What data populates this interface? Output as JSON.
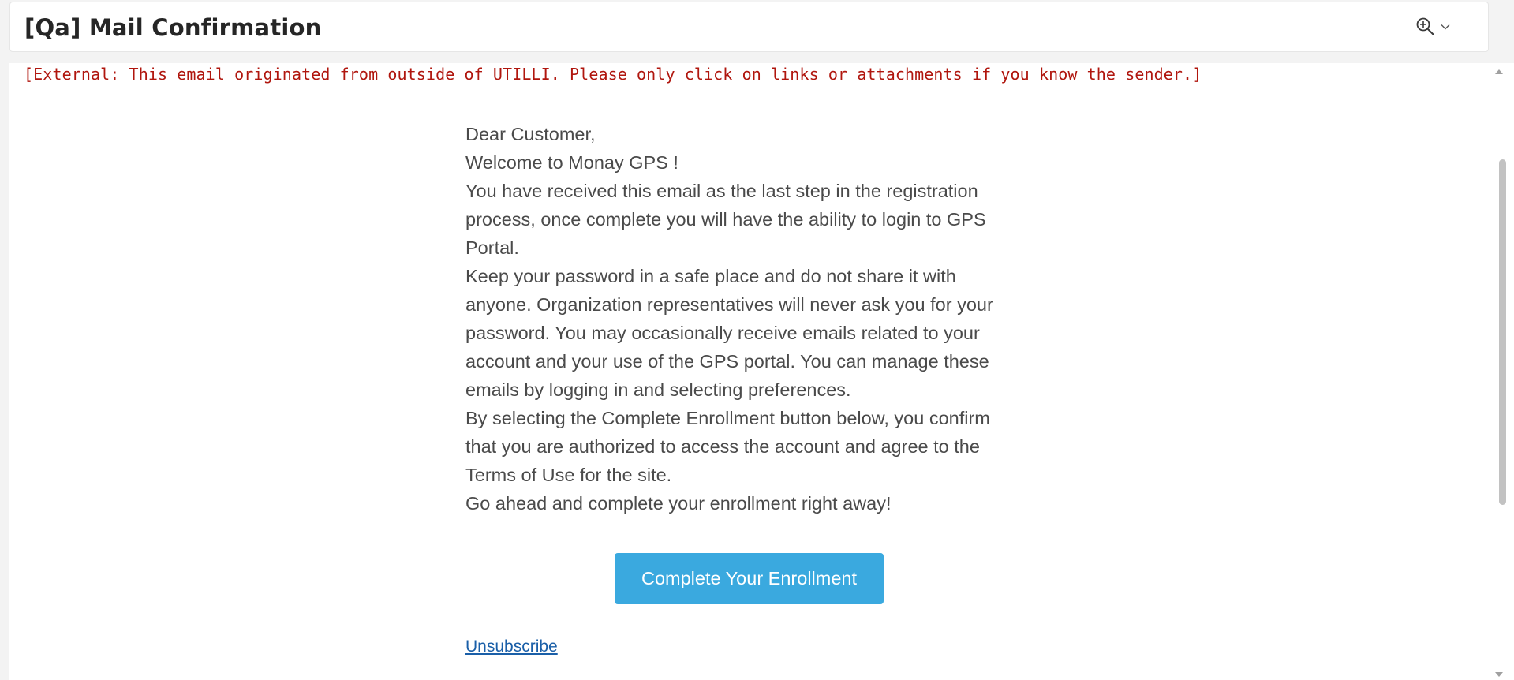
{
  "header": {
    "subject": "[Qa] Mail Confirmation",
    "zoom_icon": "zoom-in-icon",
    "zoom_dropdown_icon": "chevron-down-icon"
  },
  "warning": {
    "text": "[External: This email originated from outside of UTILLI. Please only click on links or attachments if you know the sender.]",
    "color": "#b0160e"
  },
  "email": {
    "greeting": "Dear Customer,",
    "welcome": "Welcome to Monay GPS !",
    "paragraphs": [
      "You have received this email as the last step in the registration process, once complete you will have the ability to login to GPS Portal.",
      "Keep your password in a safe place and do not share it with anyone. Organization representatives will never ask you for your password. You may occasionally receive emails related to your account and your use of the GPS portal. You can manage these emails by logging in and selecting preferences.",
      "By selecting the Complete Enrollment button below, you confirm that you are authorized to access the account and agree to the Terms of Use for the site.",
      "Go ahead and complete your enrollment right away!"
    ],
    "cta_label": "Complete Your Enrollment",
    "cta_color": "#3aa9df",
    "unsubscribe_label": "Unsubscribe"
  }
}
